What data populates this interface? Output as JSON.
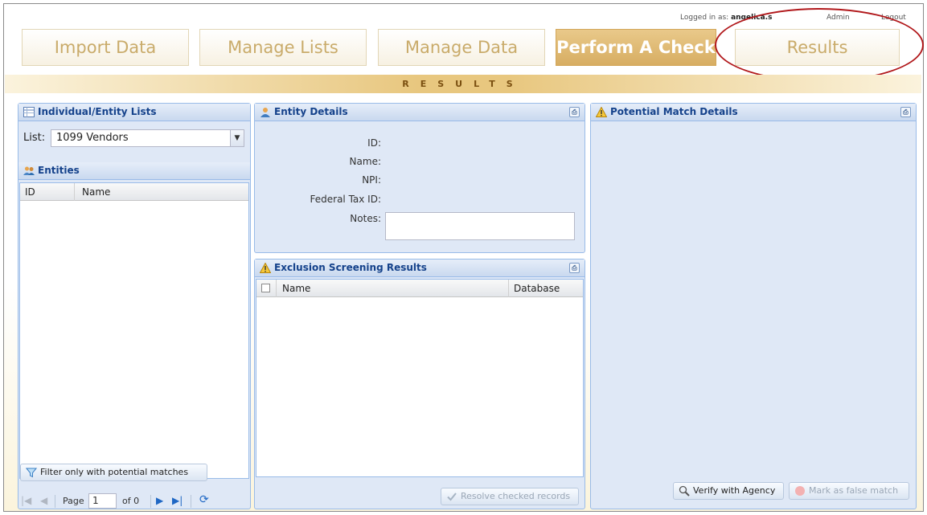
{
  "header": {
    "logged_in_prefix": "Logged in as:",
    "username": "angelica.s",
    "admin_link": "Admin",
    "logout_link": "Logout"
  },
  "nav": {
    "import": "Import Data",
    "lists": "Manage Lists",
    "data": "Manage Data",
    "check": "Perform A Check",
    "results": "Results"
  },
  "banner_text": "RESULTS",
  "lists_panel": {
    "title": "Individual/Entity Lists",
    "list_label": "List:",
    "list_value": "1099 Vendors"
  },
  "entities_panel": {
    "title": "Entities",
    "columns": [
      "ID",
      "Name"
    ],
    "filter_button": "Filter only with potential matches",
    "pager": {
      "page_label": "Page",
      "page_value": "1",
      "of_label": "of 0"
    }
  },
  "entity_details": {
    "title": "Entity Details",
    "id_label": "ID:",
    "name_label": "Name:",
    "npi_label": "NPI:",
    "tax_label": "Federal Tax ID:",
    "notes_label": "Notes:"
  },
  "exclusion": {
    "title": "Exclusion Screening Results",
    "columns": [
      "Name",
      "Database"
    ],
    "resolve_button": "Resolve checked records"
  },
  "potential": {
    "title": "Potential Match Details",
    "verify_button": "Verify with Agency",
    "false_match_button": "Mark as false match"
  },
  "colors": {
    "accent_gold": "#d7ad62",
    "panel_blue": "#dfe8f6",
    "header_blue": "#15428b",
    "highlight_circle": "#b1181b"
  }
}
